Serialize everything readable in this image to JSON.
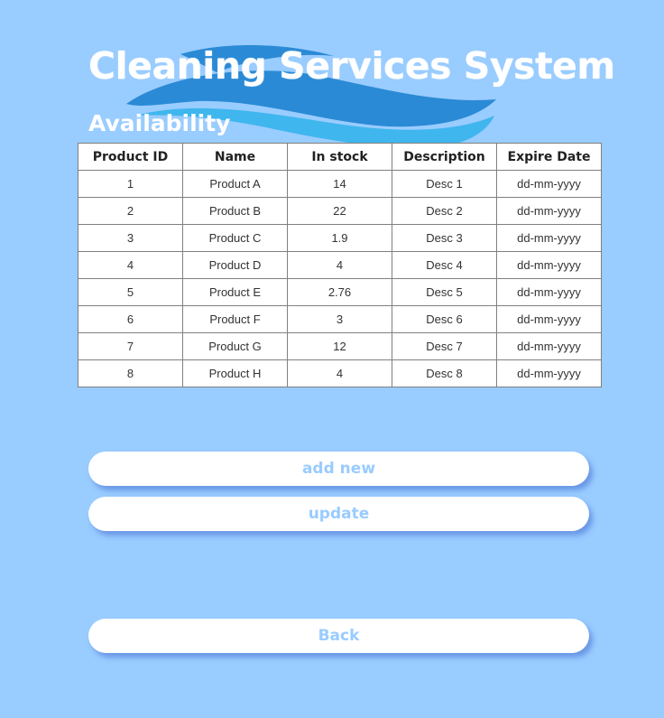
{
  "app": {
    "title": "Cleaning Services System"
  },
  "section": {
    "title": "Availability"
  },
  "table": {
    "headers": [
      "Product ID",
      "Name",
      "In stock",
      "Description",
      "Expire Date"
    ],
    "rows": [
      [
        "1",
        "Product A",
        "14",
        "Desc 1",
        "dd-mm-yyyy"
      ],
      [
        "2",
        "Product B",
        "22",
        "Desc 2",
        "dd-mm-yyyy"
      ],
      [
        "3",
        "Product C",
        "1.9",
        "Desc 3",
        "dd-mm-yyyy"
      ],
      [
        "4",
        "Product D",
        "4",
        "Desc 4",
        "dd-mm-yyyy"
      ],
      [
        "5",
        "Product E",
        "2.76",
        "Desc 5",
        "dd-mm-yyyy"
      ],
      [
        "6",
        "Product F",
        "3",
        "Desc 6",
        "dd-mm-yyyy"
      ],
      [
        "7",
        "Product G",
        "12",
        "Desc 7",
        "dd-mm-yyyy"
      ],
      [
        "8",
        "Product H",
        "4",
        "Desc 8",
        "dd-mm-yyyy"
      ]
    ]
  },
  "buttons": {
    "add_new": "add new",
    "update": "update",
    "back": "Back"
  },
  "colors": {
    "background": "#99ccff",
    "button_text": "#99ccff",
    "logo_dark_blue": "#2a8ad6",
    "logo_light_blue": "#3fb6ee"
  }
}
